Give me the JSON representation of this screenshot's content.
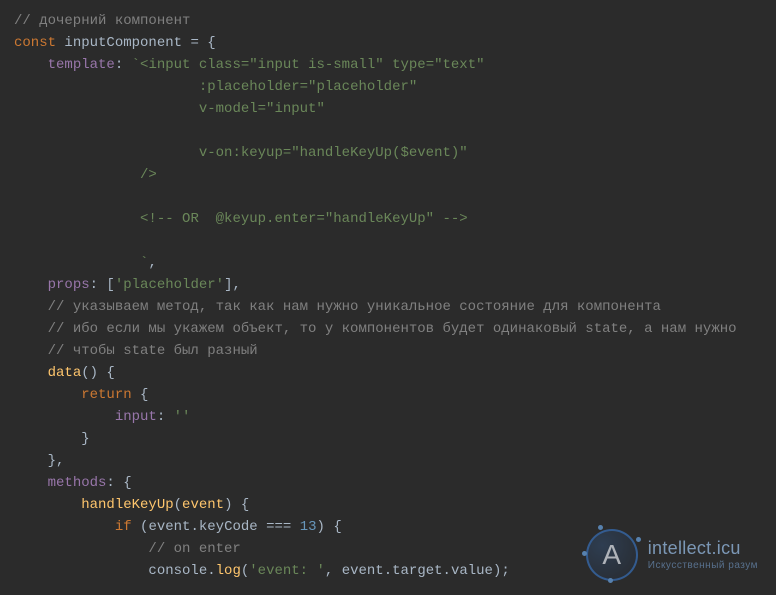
{
  "code": {
    "l1_comment": "// дочерний компонент",
    "l2_const": "const",
    "l2_name": "inputComponent",
    "l2_eq": " = {",
    "l3_prop": "template",
    "l3_colon": ": ",
    "l3_str": "`<input class=\"input is-small\" type=\"text\"",
    "l4_str": ":placeholder=\"placeholder\"",
    "l5_str": "v-model=\"input\"",
    "l7_str": "v-on:keyup=\"handleKeyUp($event)\"",
    "l8_str": "/>",
    "l10_str": "<!-- OR  @keyup.enter=\"handleKeyUp\" -->",
    "l12_str": "`",
    "l12_comma": ",",
    "l13_prop": "props",
    "l13_colonbr": ": [",
    "l13_val": "'placeholder'",
    "l13_close": "],",
    "l14_comment": "// указываем метод, так как нам нужно уникальное состояние для компонента",
    "l15_comment": "// ибо если мы укажем объект, то у компонентов будет одинаковый state, а нам нужно",
    "l16_comment": "// чтобы state был разный",
    "l17_data": "data",
    "l17_paren": "() {",
    "l18_return": "return",
    "l18_brace": " {",
    "l19_key": "input",
    "l19_colon": ": ",
    "l19_val": "''",
    "l20_brace": "}",
    "l21_brace": "},",
    "l22_prop": "methods",
    "l22_colon": ": {",
    "l23_name": "handleKeyUp",
    "l23_open": "(",
    "l23_param": "event",
    "l23_close": ") {",
    "l24_if": "if",
    "l24_open": " (",
    "l24_obj": "event",
    "l24_dot1": ".",
    "l24_kc": "keyCode",
    "l24_eq": " === ",
    "l24_num": "13",
    "l24_close": ") {",
    "l25_comment": "// on enter",
    "l26_console": "console",
    "l26_dot": ".",
    "l26_log": "log",
    "l26_open": "(",
    "l26_str": "'event: '",
    "l26_comma": ", ",
    "l26_ev": "event",
    "l26_dot2": ".",
    "l26_tgt": "target",
    "l26_dot3": ".",
    "l26_val": "value",
    "l26_close": ");"
  },
  "watermark": {
    "letter": "A",
    "title": "intellect.icu",
    "subtitle": "Искусственный разум"
  }
}
